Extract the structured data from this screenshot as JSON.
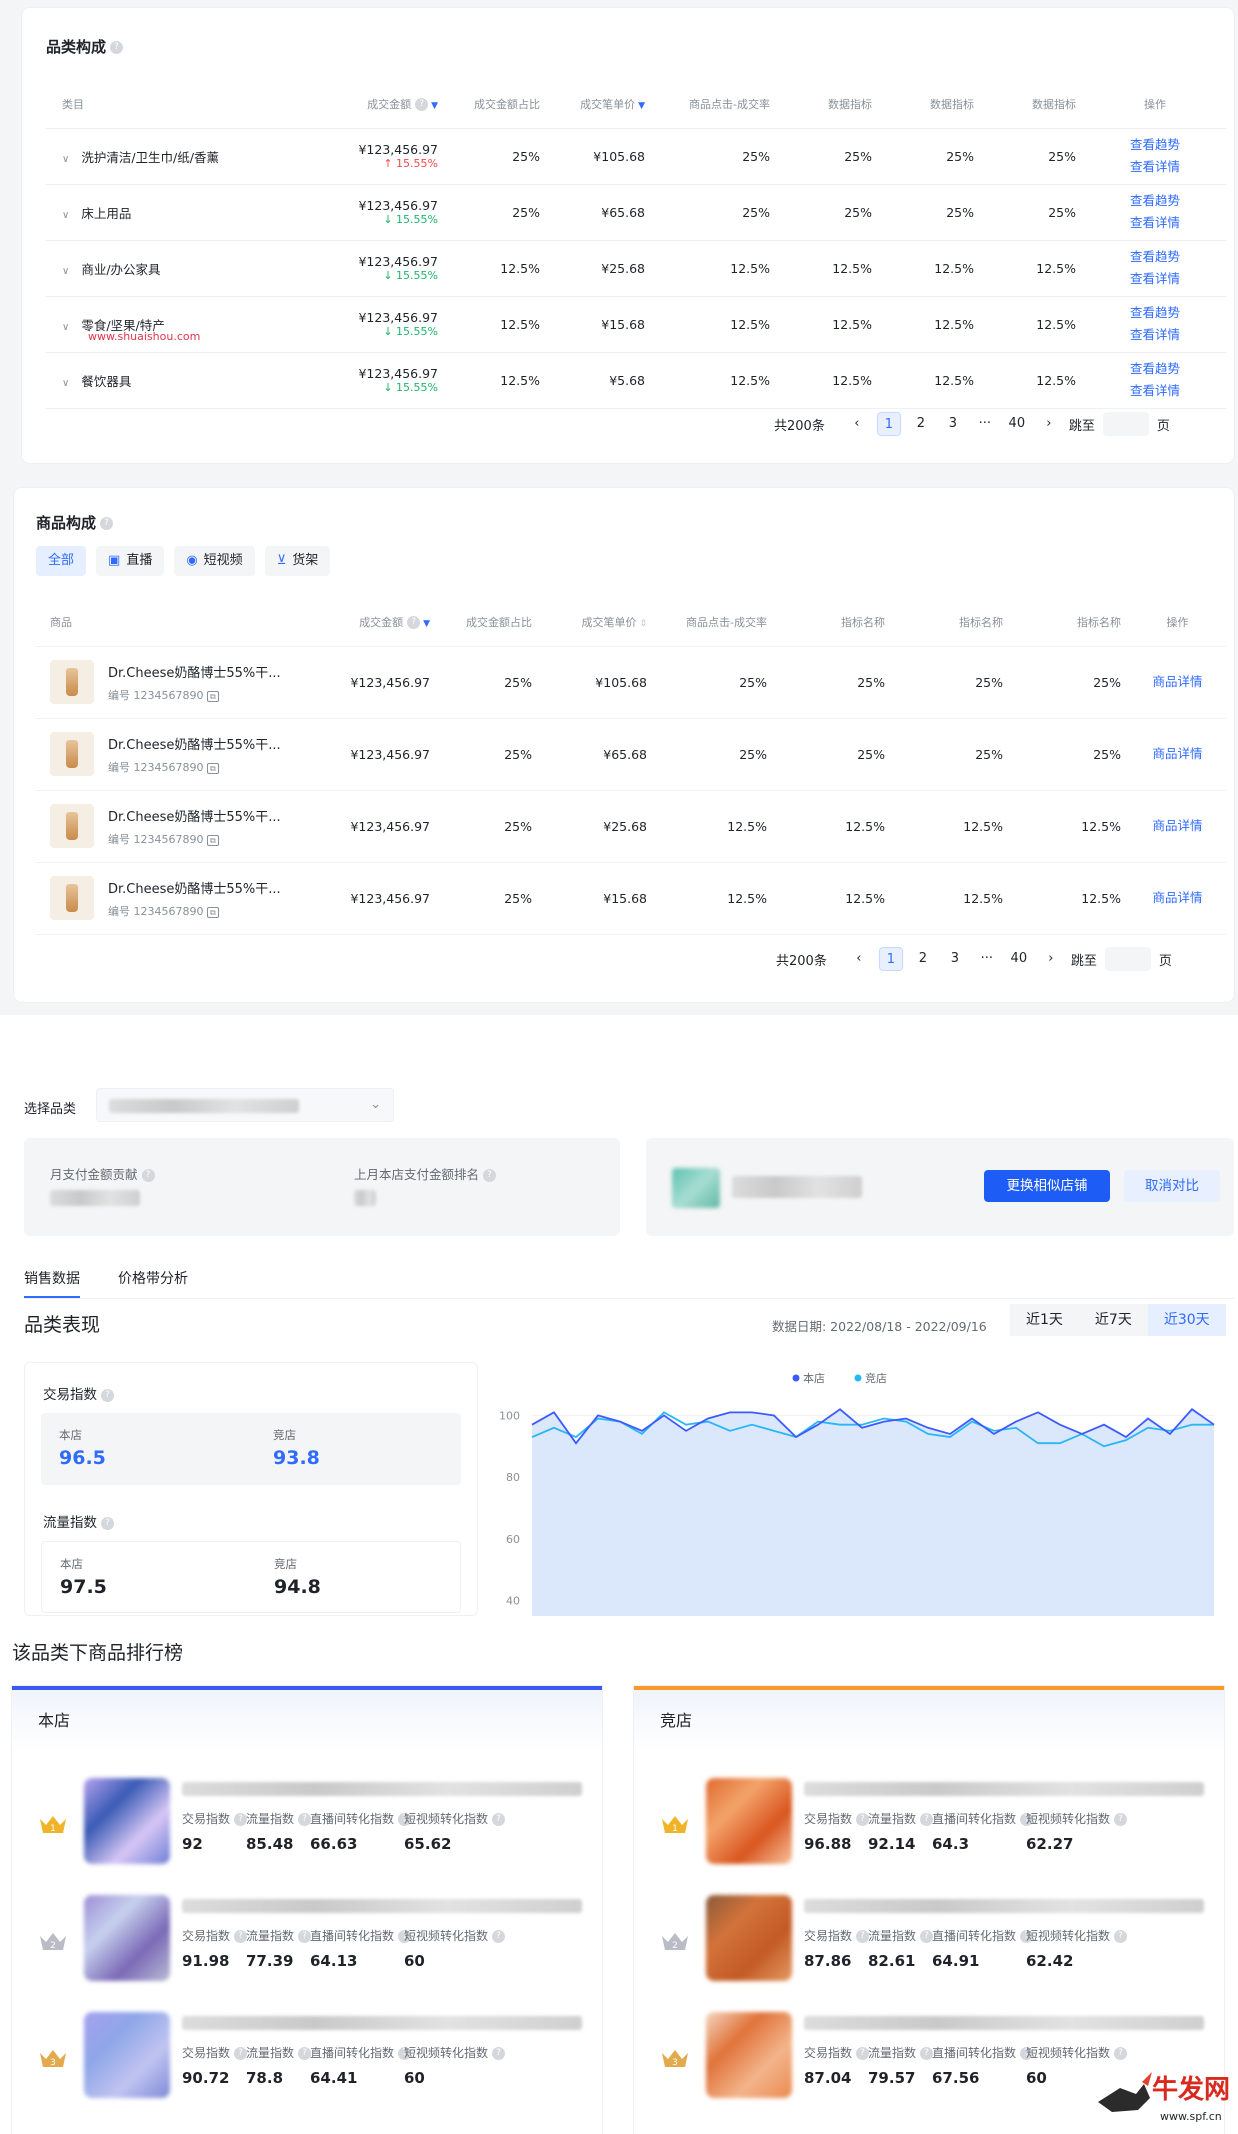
{
  "category_section": {
    "title": "品类构成",
    "headers": [
      "类目",
      "成交金额",
      "成交金额占比",
      "成交笔单价",
      "商品点击-成交率",
      "数据指标",
      "数据指标",
      "数据指标",
      "操作"
    ],
    "rows": [
      {
        "name": "洗护清洁/卫生巾/纸/香薰",
        "amount": "¥123,456.97",
        "change": "15.55%",
        "dir": "up",
        "share": "25%",
        "price": "¥105.68",
        "rate": "25%",
        "m1": "25%",
        "m2": "25%",
        "m3": "25%"
      },
      {
        "name": "床上用品",
        "amount": "¥123,456.97",
        "change": "15.55%",
        "dir": "down",
        "share": "25%",
        "price": "¥65.68",
        "rate": "25%",
        "m1": "25%",
        "m2": "25%",
        "m3": "25%"
      },
      {
        "name": "商业/办公家具",
        "amount": "¥123,456.97",
        "change": "15.55%",
        "dir": "down",
        "share": "12.5%",
        "price": "¥25.68",
        "rate": "12.5%",
        "m1": "12.5%",
        "m2": "12.5%",
        "m3": "12.5%"
      },
      {
        "name": "零食/坚果/特产",
        "amount": "¥123,456.97",
        "change": "15.55%",
        "dir": "down",
        "share": "12.5%",
        "price": "¥15.68",
        "rate": "12.5%",
        "m1": "12.5%",
        "m2": "12.5%",
        "m3": "12.5%"
      },
      {
        "name": "餐饮器具",
        "amount": "¥123,456.97",
        "change": "15.55%",
        "dir": "down",
        "share": "12.5%",
        "price": "¥5.68",
        "rate": "12.5%",
        "m1": "12.5%",
        "m2": "12.5%",
        "m3": "12.5%"
      }
    ],
    "op_trend": "查看趋势",
    "op_detail": "查看详情",
    "watermark": "www.shuaishou.com",
    "pager": {
      "total": "共200条",
      "pages": [
        "1",
        "2",
        "3",
        "···",
        "40"
      ],
      "jump": "跳至",
      "page": "页"
    }
  },
  "product_section": {
    "title": "商品构成",
    "tabs": [
      "全部",
      "直播",
      "短视频",
      "货架"
    ],
    "headers": [
      "商品",
      "成交金额",
      "成交金额占比",
      "成交笔单价",
      "商品点击-成交率",
      "指标名称",
      "指标名称",
      "指标名称",
      "操作"
    ],
    "rows": [
      {
        "name": "Dr.Cheese奶酪博士55%干...",
        "id": "编号 1234567890",
        "amount": "¥123,456.97",
        "share": "25%",
        "price": "¥105.68",
        "rate": "25%",
        "m1": "25%",
        "m2": "25%",
        "m3": "25%"
      },
      {
        "name": "Dr.Cheese奶酪博士55%干...",
        "id": "编号 1234567890",
        "amount": "¥123,456.97",
        "share": "25%",
        "price": "¥65.68",
        "rate": "25%",
        "m1": "25%",
        "m2": "25%",
        "m3": "25%"
      },
      {
        "name": "Dr.Cheese奶酪博士55%干...",
        "id": "编号 1234567890",
        "amount": "¥123,456.97",
        "share": "25%",
        "price": "¥25.68",
        "rate": "12.5%",
        "m1": "12.5%",
        "m2": "12.5%",
        "m3": "12.5%"
      },
      {
        "name": "Dr.Cheese奶酪博士55%干...",
        "id": "编号 1234567890",
        "amount": "¥123,456.97",
        "share": "25%",
        "price": "¥15.68",
        "rate": "12.5%",
        "m1": "12.5%",
        "m2": "12.5%",
        "m3": "12.5%"
      }
    ],
    "op": "商品详情",
    "pager": {
      "total": "共200条",
      "pages": [
        "1",
        "2",
        "3",
        "···",
        "40"
      ],
      "jump": "跳至",
      "page": "页"
    }
  },
  "compare": {
    "select_label": "选择品类",
    "month_contrib": "月支付金额贡献",
    "last_month_rank": "上月本店支付金额排名",
    "swap_button": "更换相似店铺",
    "cancel_button": "取消对比",
    "tabs": [
      "销售数据",
      "价格带分析"
    ],
    "perf_title": "品类表现",
    "date_label": "数据日期: 2022/08/18 - 2022/09/16",
    "ranges": [
      "近1天",
      "近7天",
      "近30天"
    ],
    "trade_index": {
      "label": "交易指数",
      "own_label": "本店",
      "own": "96.5",
      "rival_label": "竞店",
      "rival": "93.8"
    },
    "traffic_index": {
      "label": "流量指数",
      "own_label": "本店",
      "own": "97.5",
      "rival_label": "竞店",
      "rival": "94.8"
    }
  },
  "chart_data": {
    "type": "line",
    "legend": [
      "本店",
      "竞店"
    ],
    "yticks": [
      100,
      80,
      60,
      40
    ],
    "ylim": [
      35,
      105
    ],
    "series": [
      {
        "name": "本店",
        "color": "#3d5afe",
        "values": [
          97,
          101,
          91,
          100,
          98,
          95,
          100,
          95,
          99,
          101,
          101,
          100,
          93,
          97,
          102,
          96,
          98,
          99,
          96,
          94,
          99,
          94,
          98,
          101,
          97,
          94,
          97,
          93,
          99,
          94,
          102,
          97
        ]
      },
      {
        "name": "竞店",
        "color": "#29b6f6",
        "values": [
          93,
          96,
          93,
          99,
          98,
          94,
          101,
          97,
          98,
          95,
          97,
          95,
          93,
          98,
          97,
          97,
          99,
          98,
          94,
          93,
          98,
          95,
          96,
          91,
          91,
          94,
          90,
          92,
          96,
          95,
          97,
          97
        ]
      }
    ]
  },
  "ranking": {
    "title": "该品类下商品排行榜",
    "own_title": "本店",
    "rival_title": "竞店",
    "labels": [
      "交易指数",
      "流量指数",
      "直播间转化指数",
      "短视频转化指数"
    ],
    "own": [
      {
        "rank": "1",
        "v": [
          "92",
          "85.48",
          "66.63",
          "65.62"
        ]
      },
      {
        "rank": "2",
        "v": [
          "91.98",
          "77.39",
          "64.13",
          "60"
        ]
      },
      {
        "rank": "3",
        "v": [
          "90.72",
          "78.8",
          "64.41",
          "60"
        ]
      }
    ],
    "rival": [
      {
        "rank": "1",
        "v": [
          "96.88",
          "92.14",
          "64.3",
          "62.27"
        ]
      },
      {
        "rank": "2",
        "v": [
          "87.86",
          "82.61",
          "64.91",
          "62.42"
        ]
      },
      {
        "rank": "3",
        "v": [
          "87.04",
          "79.57",
          "67.56",
          "60"
        ]
      }
    ]
  },
  "footer_logo": "www.spf.cn"
}
